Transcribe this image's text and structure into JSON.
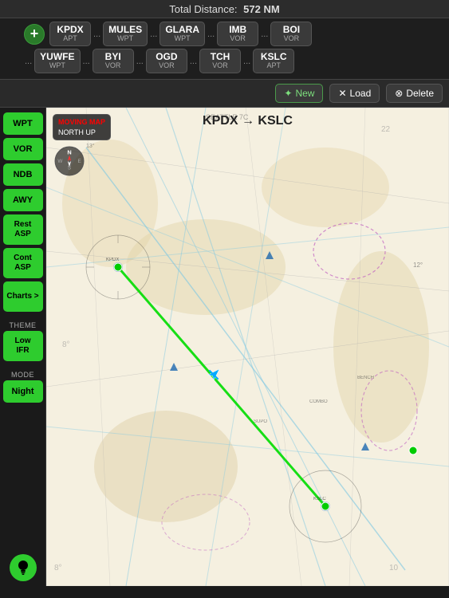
{
  "topBar": {
    "label": "Total Distance:",
    "value": "572 NM"
  },
  "waypoints": {
    "addButton": "+",
    "row1": [
      {
        "id": "KPDX",
        "type": "APT"
      },
      {
        "sep": "..."
      },
      {
        "id": "MULES",
        "type": "WPT"
      },
      {
        "sep": "..."
      },
      {
        "id": "GLARA",
        "type": "WPT"
      },
      {
        "sep": "..."
      },
      {
        "id": "IMB",
        "type": "VOR"
      },
      {
        "sep": "..."
      },
      {
        "id": "BOI",
        "type": "VOR"
      }
    ],
    "row2": [
      {
        "sep": "..."
      },
      {
        "id": "YUWFE",
        "type": "WPT"
      },
      {
        "sep": "..."
      },
      {
        "id": "BYI",
        "type": "VOR"
      },
      {
        "sep": "..."
      },
      {
        "id": "OGD",
        "type": "VOR"
      },
      {
        "sep": "..."
      },
      {
        "id": "TCH",
        "type": "VOR"
      },
      {
        "sep": "..."
      },
      {
        "id": "KSLC",
        "type": "APT"
      }
    ]
  },
  "toolbar": {
    "newLabel": "New",
    "loadLabel": "Load",
    "deleteLabel": "Delete"
  },
  "sidebar": {
    "items": [
      {
        "label": "WPT"
      },
      {
        "label": "VOR"
      },
      {
        "label": "NDB"
      },
      {
        "label": "AWY"
      },
      {
        "label": "Rest\nASP"
      },
      {
        "label": "Cont\nASP"
      },
      {
        "label": "Charts >"
      }
    ],
    "themeLabel": "THEME",
    "themeBtn": "Low\nIFR",
    "modeLabel": "MODE",
    "modeBtn": "Night"
  },
  "map": {
    "title": "KPDX → KSLC",
    "movingMapLabel": "MOVING MAP",
    "northUpLabel": "NORTH UP",
    "compassLabel": "N"
  },
  "colors": {
    "green": "#2ecc2e",
    "darkBg": "#1a1a1a",
    "sidebarBg": "#1a1a1a",
    "buttonBg": "#3a3a3a"
  }
}
